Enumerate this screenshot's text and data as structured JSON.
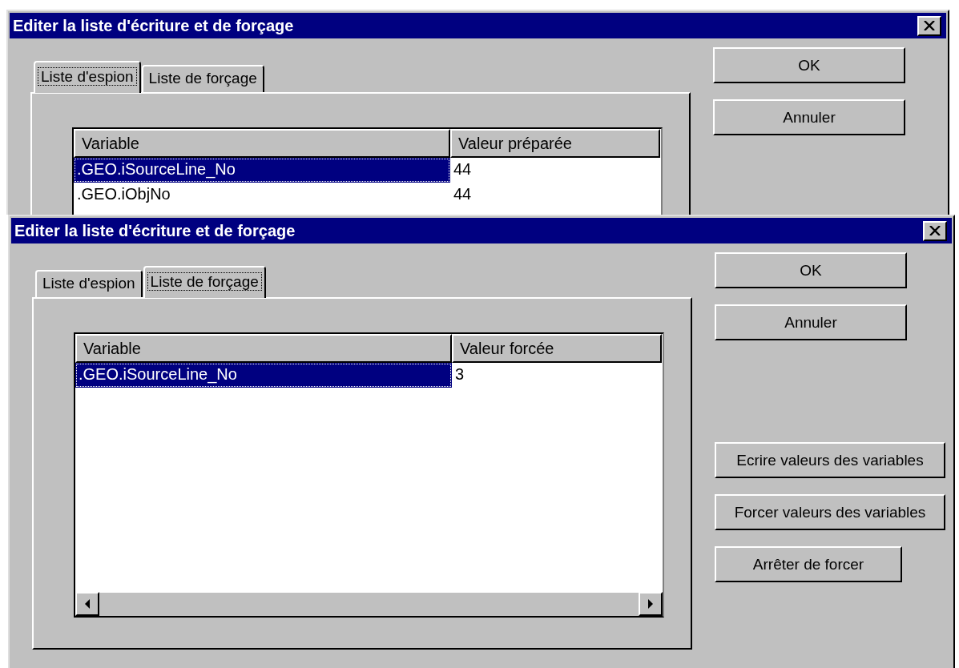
{
  "dialogs": [
    {
      "title": "Editer la liste d'écriture et de forçage",
      "tabs": [
        {
          "label": "Liste d'espion",
          "selected": true
        },
        {
          "label": "Liste de forçage",
          "selected": false
        }
      ],
      "table": {
        "columns": [
          "Variable",
          "Valeur préparée"
        ],
        "rows": [
          {
            "cells": [
              ".GEO.iSourceLine_No",
              "44"
            ],
            "selected": true
          },
          {
            "cells": [
              ".GEO.iObjNo",
              "44"
            ],
            "selected": false
          }
        ]
      },
      "buttons": [
        "OK",
        "Annuler"
      ]
    },
    {
      "title": "Editer la liste d'écriture et de forçage",
      "tabs": [
        {
          "label": "Liste d'espion",
          "selected": false
        },
        {
          "label": "Liste de forçage",
          "selected": true
        }
      ],
      "table": {
        "columns": [
          "Variable",
          "Valeur forcée"
        ],
        "rows": [
          {
            "cells": [
              ".GEO.iSourceLine_No",
              "3"
            ],
            "selected": true
          }
        ]
      },
      "buttons": [
        "OK",
        "Annuler"
      ],
      "action_buttons": [
        "Ecrire valeurs des variables",
        "Forcer valeurs des variables",
        "Arrêter de forcer"
      ]
    }
  ]
}
